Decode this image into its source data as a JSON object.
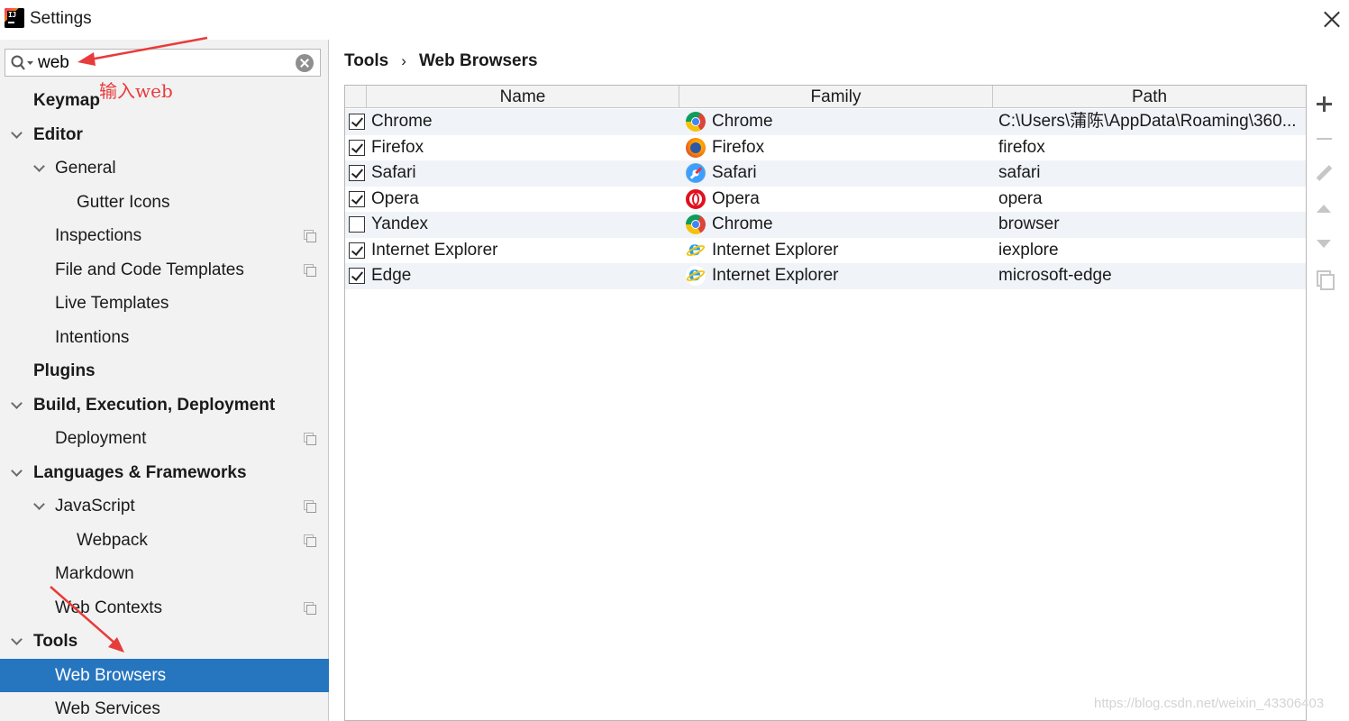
{
  "window": {
    "title": "Settings"
  },
  "search": {
    "value": "web"
  },
  "annotation": {
    "text": "输入web"
  },
  "sidebar": {
    "items": [
      {
        "label": "Keymap"
      },
      {
        "label": "Editor"
      },
      {
        "label": "General"
      },
      {
        "label": "Gutter Icons"
      },
      {
        "label": "Inspections"
      },
      {
        "label": "File and Code Templates"
      },
      {
        "label": "Live Templates"
      },
      {
        "label": "Intentions"
      },
      {
        "label": "Plugins"
      },
      {
        "label": "Build, Execution, Deployment"
      },
      {
        "label": "Deployment"
      },
      {
        "label": "Languages & Frameworks"
      },
      {
        "label": "JavaScript"
      },
      {
        "label": "Webpack"
      },
      {
        "label": "Markdown"
      },
      {
        "label": "Web Contexts"
      },
      {
        "label": "Tools"
      },
      {
        "label": "Web Browsers"
      },
      {
        "label": "Web Services"
      }
    ]
  },
  "breadcrumb": {
    "parent": "Tools",
    "separator": "›",
    "current": "Web Browsers"
  },
  "table": {
    "headers": {
      "name": "Name",
      "family": "Family",
      "path": "Path"
    },
    "rows": [
      {
        "name": "Chrome",
        "family": "Chrome",
        "path": "C:\\Users\\蒲陈\\AppData\\Roaming\\360...",
        "checked": true,
        "icon": "chrome-icon"
      },
      {
        "name": "Firefox",
        "family": "Firefox",
        "path": "firefox",
        "checked": true,
        "icon": "firefox-icon"
      },
      {
        "name": "Safari",
        "family": "Safari",
        "path": "safari",
        "checked": true,
        "icon": "safari-icon"
      },
      {
        "name": "Opera",
        "family": "Opera",
        "path": "opera",
        "checked": true,
        "icon": "opera-icon"
      },
      {
        "name": "Yandex",
        "family": "Chrome",
        "path": "browser",
        "checked": false,
        "icon": "chrome-icon"
      },
      {
        "name": "Internet Explorer",
        "family": "Internet Explorer",
        "path": "iexplore",
        "checked": true,
        "icon": "ie-icon"
      },
      {
        "name": "Edge",
        "family": "Internet Explorer",
        "path": "microsoft-edge",
        "checked": true,
        "icon": "ie-icon"
      }
    ]
  },
  "watermark": {
    "text": "https://blog.csdn.net/weixin_43306403"
  },
  "colors": {
    "selection": "#2675bf",
    "annotation": "#e83b3b"
  }
}
